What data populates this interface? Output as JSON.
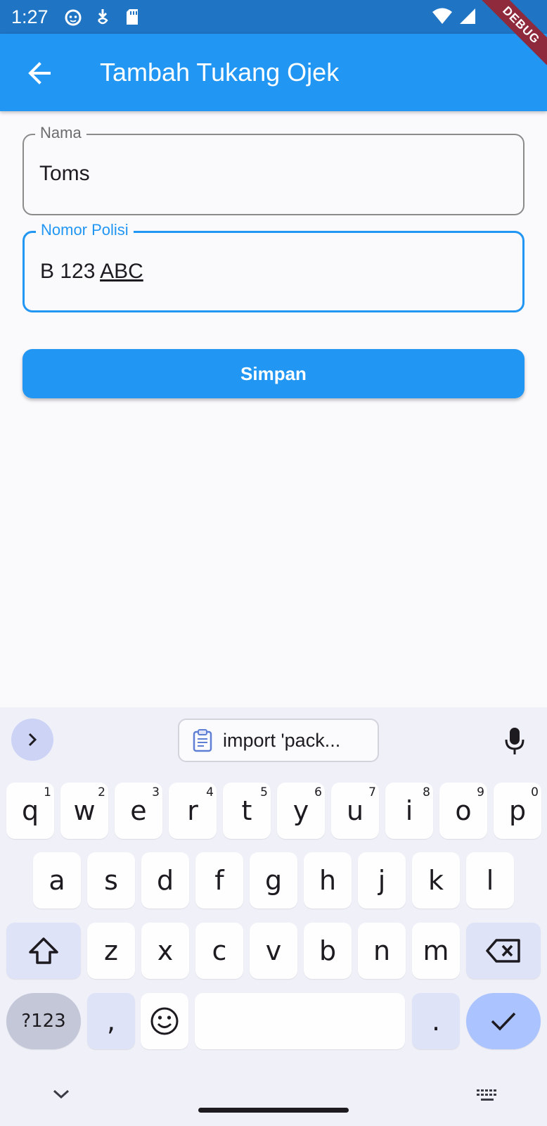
{
  "status_bar": {
    "time": "1:27",
    "icons": [
      "cat-app-icon",
      "download-notification-icon",
      "sd-card-icon",
      "wifi-icon",
      "signal-icon"
    ]
  },
  "debug_banner": "DEBUG",
  "app_bar": {
    "title": "Tambah Tukang Ojek",
    "back_icon": "arrow-back-icon"
  },
  "form": {
    "nama": {
      "label": "Nama",
      "value": "Toms"
    },
    "nomor_polisi": {
      "label": "Nomor Polisi",
      "value_plain": "B 123 ",
      "value_composing": "ABC"
    },
    "save_label": "Simpan"
  },
  "keyboard": {
    "clipboard_suggestion": "import 'pack...",
    "row1": [
      {
        "k": "q",
        "h": "1"
      },
      {
        "k": "w",
        "h": "2"
      },
      {
        "k": "e",
        "h": "3"
      },
      {
        "k": "r",
        "h": "4"
      },
      {
        "k": "t",
        "h": "5"
      },
      {
        "k": "y",
        "h": "6"
      },
      {
        "k": "u",
        "h": "7"
      },
      {
        "k": "i",
        "h": "8"
      },
      {
        "k": "o",
        "h": "9"
      },
      {
        "k": "p",
        "h": "0"
      }
    ],
    "row2": [
      "a",
      "s",
      "d",
      "f",
      "g",
      "h",
      "j",
      "k",
      "l"
    ],
    "row3": [
      "z",
      "x",
      "c",
      "v",
      "b",
      "n",
      "m"
    ],
    "numbers_label": "?123",
    "comma": ",",
    "period": ".",
    "colors": {
      "accent": "#2196f3",
      "status_bar": "#1f74c4",
      "debug": "#8f2a3c",
      "enter_key": "#abc3ff"
    }
  }
}
